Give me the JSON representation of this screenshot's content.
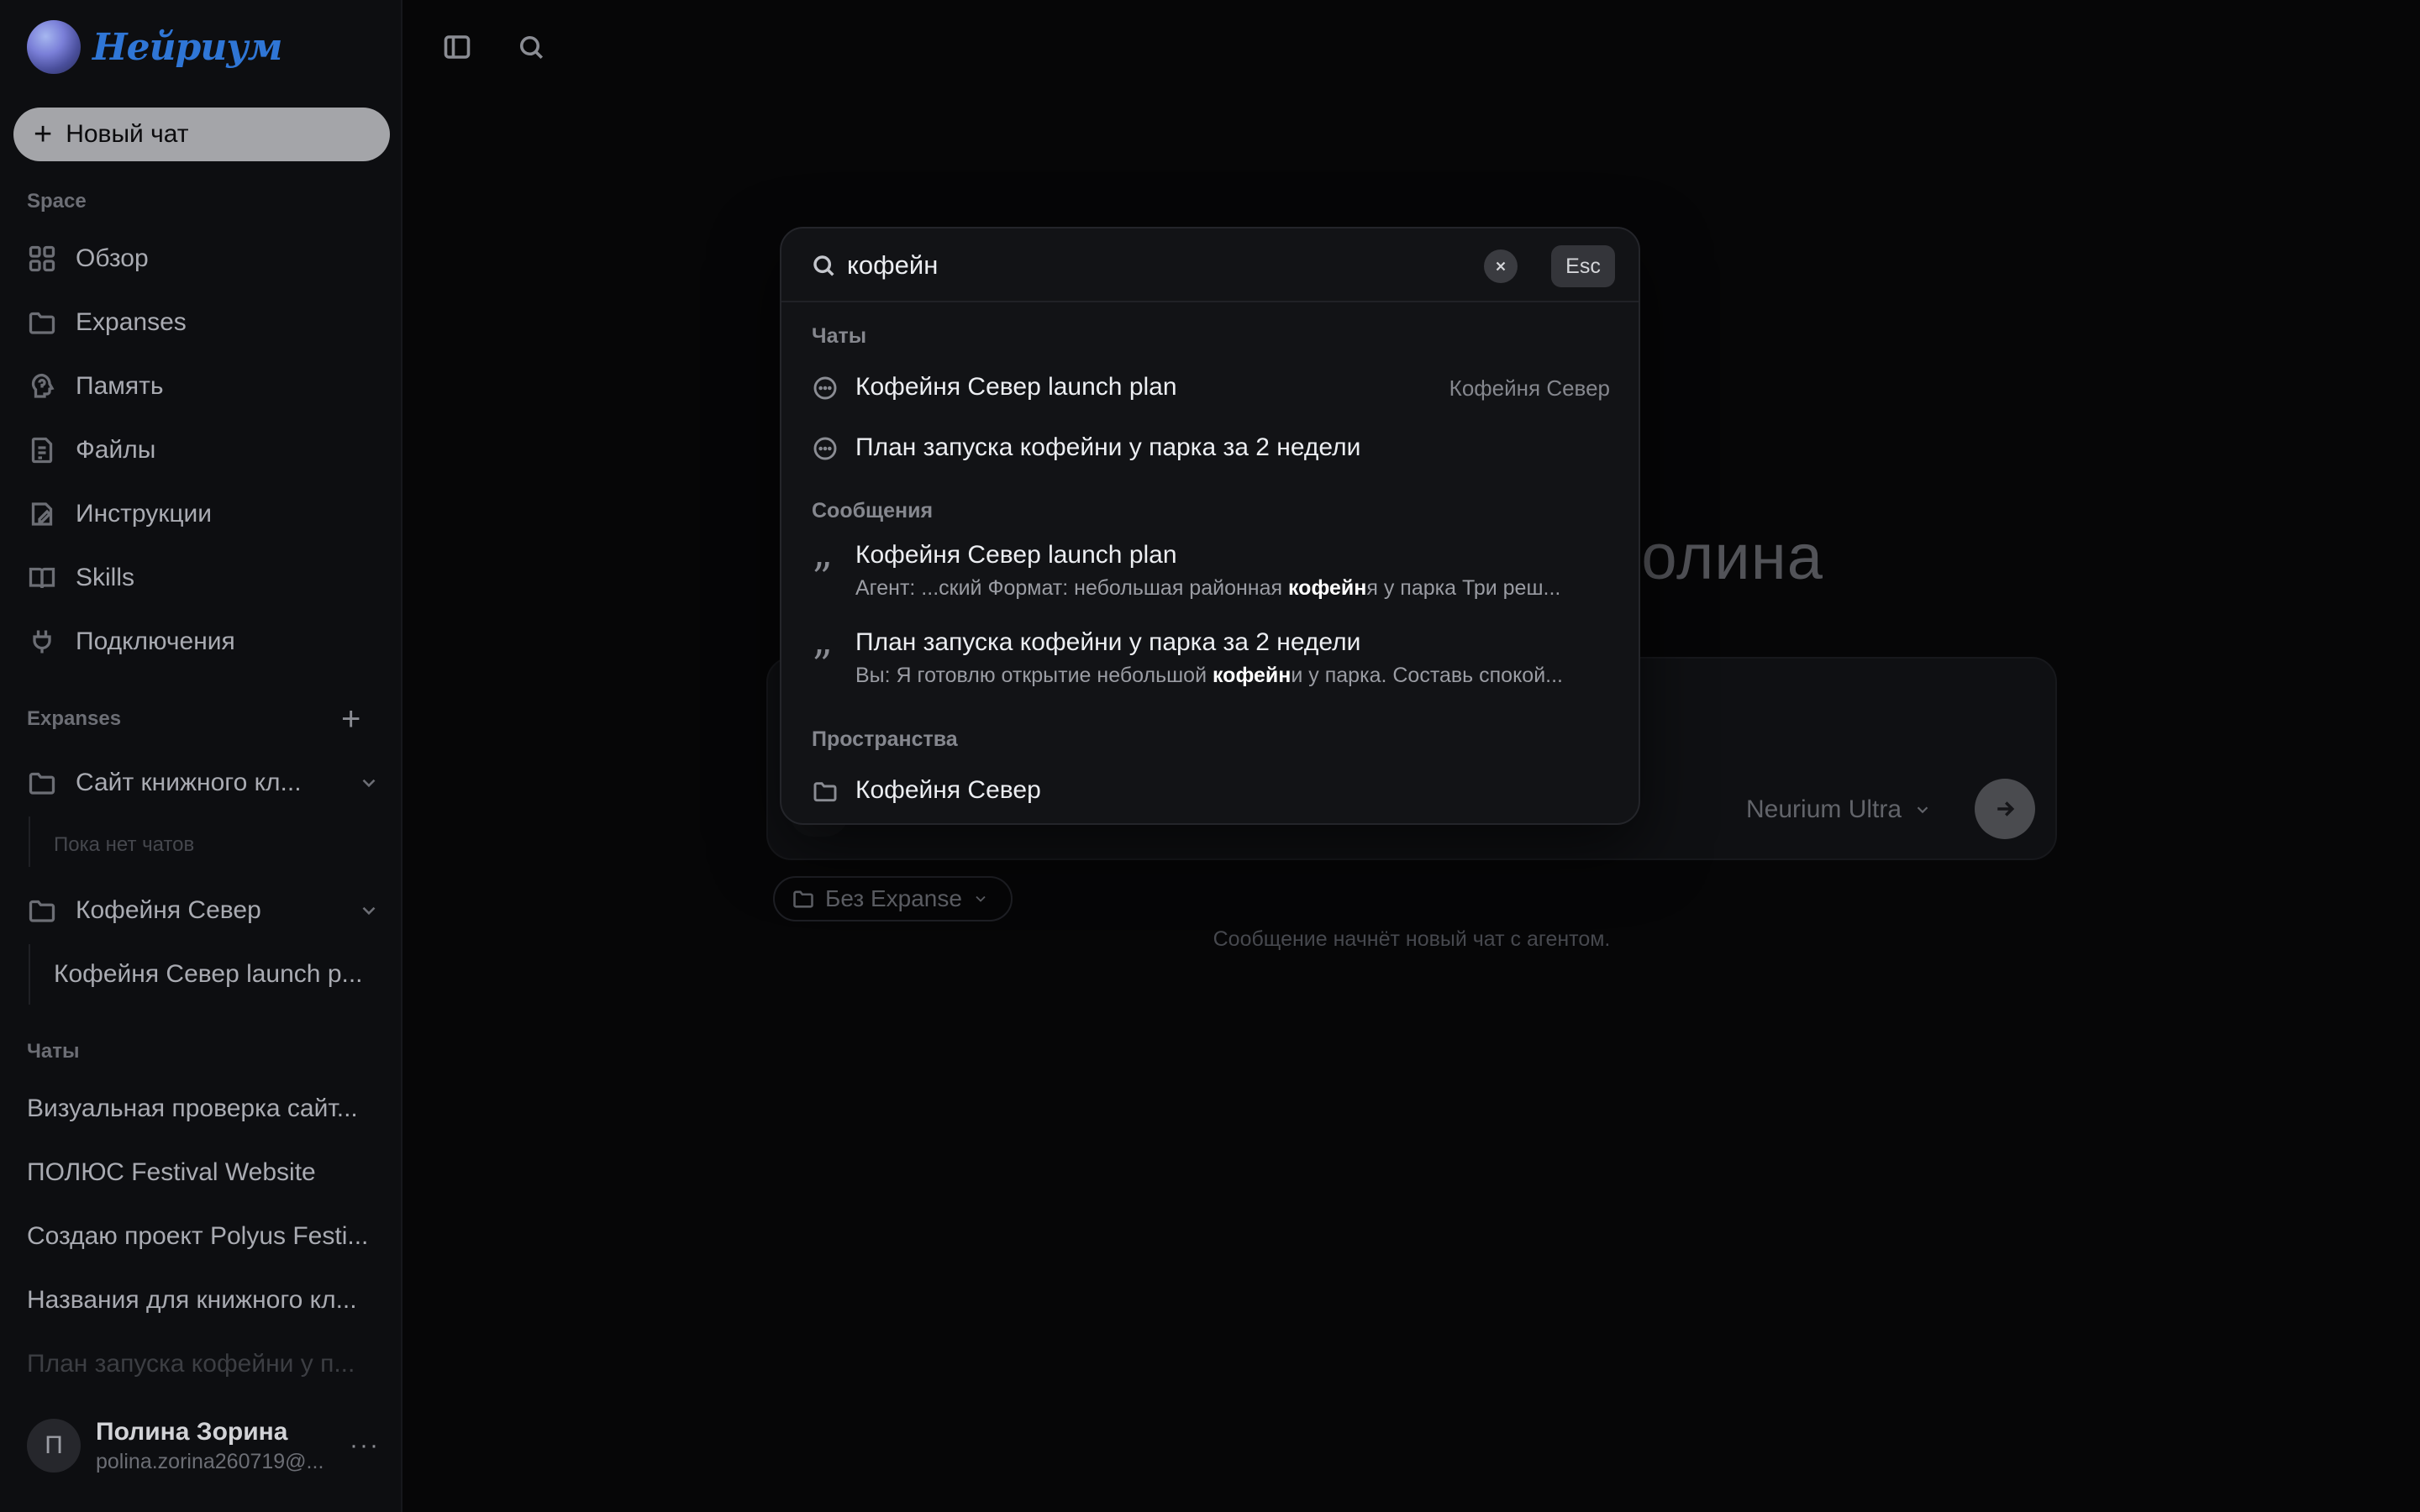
{
  "app": {
    "logo_text": "Нейриум"
  },
  "sidebar": {
    "new_chat_label": "Новый чат",
    "space_label": "Space",
    "nav": [
      {
        "label": "Обзор",
        "icon": "grid-icon"
      },
      {
        "label": "Expanses",
        "icon": "folder-icon"
      },
      {
        "label": "Память",
        "icon": "brain-icon"
      },
      {
        "label": "Файлы",
        "icon": "file-icon"
      },
      {
        "label": "Инструкции",
        "icon": "instructions-icon"
      },
      {
        "label": "Skills",
        "icon": "book-icon"
      },
      {
        "label": "Подключения",
        "icon": "plug-icon"
      }
    ],
    "expanses_label": "Expanses",
    "expanses": [
      {
        "label": "Сайт книжного кл...",
        "empty_text": "Пока нет чатов"
      },
      {
        "label": "Кофейня Север",
        "child": "Кофейня Север launch p..."
      }
    ],
    "chats_label": "Чаты",
    "chats": [
      "Визуальная проверка сайт...",
      "ПОЛЮС Festival Website",
      "Создаю проект Polyus Festi...",
      "Названия для книжного кл...",
      "План запуска кофейни у п..."
    ],
    "user": {
      "initial": "П",
      "name": "Полина Зорина",
      "email": "polina.zorina260719@...",
      "more": "···"
    }
  },
  "main": {
    "greeting_tail": "олина",
    "model": "Neurium Ultra",
    "expanse_chip": "Без Expanse",
    "hint": "Сообщение начнёт новый чат с агентом."
  },
  "search": {
    "query": "кофейн",
    "esc_label": "Esc",
    "groups": {
      "chats_label": "Чаты",
      "messages_label": "Сообщения",
      "spaces_label": "Пространства"
    },
    "chats": [
      {
        "title": "Кофейня Север launch plan",
        "meta": "Кофейня Север"
      },
      {
        "title": "План запуска кофейни у парка за 2 недели",
        "meta": ""
      }
    ],
    "messages": [
      {
        "title": "Кофейня Север launch plan",
        "snippet_before": "Агент: ...ский Формат: небольшая районная ",
        "snippet_match": "кофейн",
        "snippet_after": "я у парка Три реш..."
      },
      {
        "title": "План запуска кофейни у парка за 2 недели",
        "snippet_before": "Вы: Я готовлю открытие небольшой ",
        "snippet_match": "кофейн",
        "snippet_after": "и у парка. Составь спокой..."
      }
    ],
    "spaces": [
      {
        "title": "Кофейня Север"
      }
    ]
  }
}
